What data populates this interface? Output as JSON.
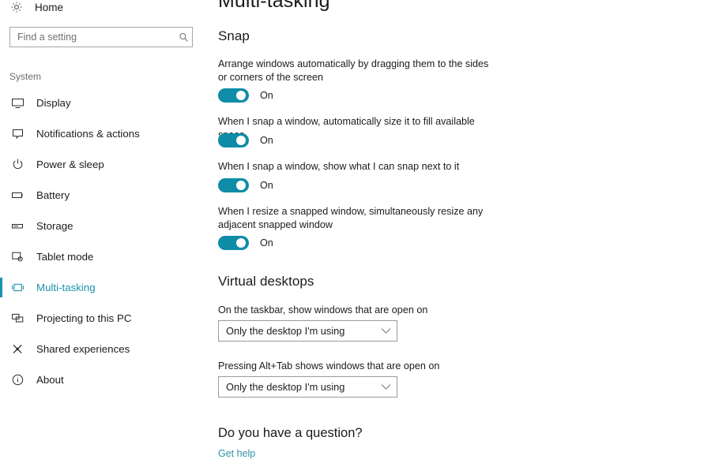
{
  "sidebar": {
    "home": {
      "label": "Home",
      "icon": "gear-icon"
    },
    "search": {
      "placeholder": "Find a setting",
      "value": "",
      "icon": "search-icon"
    },
    "group_label": "System",
    "items": [
      {
        "label": "Display",
        "icon": "monitor-icon",
        "selected": false
      },
      {
        "label": "Notifications & actions",
        "icon": "notification-icon",
        "selected": false
      },
      {
        "label": "Power & sleep",
        "icon": "power-icon",
        "selected": false
      },
      {
        "label": "Battery",
        "icon": "battery-icon",
        "selected": false
      },
      {
        "label": "Storage",
        "icon": "storage-icon",
        "selected": false
      },
      {
        "label": "Tablet mode",
        "icon": "tablet-icon",
        "selected": false
      },
      {
        "label": "Multi-tasking",
        "icon": "multitasking-icon",
        "selected": true
      },
      {
        "label": "Projecting to this PC",
        "icon": "projecting-icon",
        "selected": false
      },
      {
        "label": "Shared experiences",
        "icon": "share-icon",
        "selected": false
      },
      {
        "label": "About",
        "icon": "info-icon",
        "selected": false
      }
    ]
  },
  "main": {
    "page_title": "Multi-tasking",
    "snap": {
      "heading": "Snap",
      "settings": [
        {
          "caption": "Arrange windows automatically by dragging them to the sides or corners of the screen",
          "state": "On",
          "on": true
        },
        {
          "caption": "When I snap a window, automatically size it to fill available space",
          "state": "On",
          "on": true
        },
        {
          "caption": "When I snap a window, show what I can snap next to it",
          "state": "On",
          "on": true
        },
        {
          "caption": "When I resize a snapped window, simultaneously resize any adjacent snapped window",
          "state": "On",
          "on": true
        }
      ]
    },
    "virtual_desktops": {
      "heading": "Virtual desktops",
      "settings": [
        {
          "caption": "On the taskbar, show windows that are open on",
          "value": "Only the desktop I'm using"
        },
        {
          "caption": "Pressing Alt+Tab shows windows that are open on",
          "value": "Only the desktop I'm using"
        }
      ]
    },
    "help": {
      "heading": "Do you have a question?",
      "link": "Get help"
    }
  },
  "colors": {
    "accent": "#0e8ca8",
    "selected_text": "#1d92ad",
    "link": "#2e93ab"
  }
}
